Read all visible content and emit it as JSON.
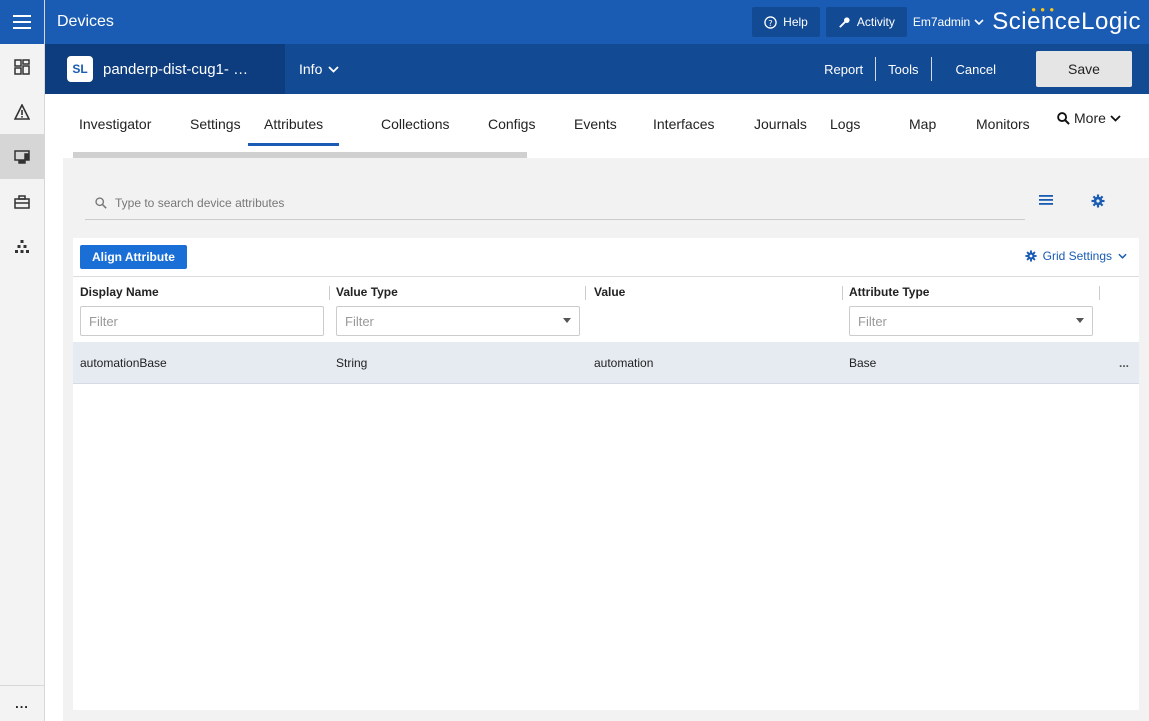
{
  "topbar": {
    "title": "Devices",
    "help_label": "Help",
    "activity_label": "Activity",
    "user_label": "Em7admin",
    "brand": "ScienceLogic"
  },
  "device": {
    "logo_text": "SL",
    "name": "panderp-dist-cug1- …",
    "info_label": "Info",
    "report_label": "Report",
    "tools_label": "Tools",
    "cancel_label": "Cancel",
    "save_label": "Save"
  },
  "tabs": [
    "Investigator",
    "Settings",
    "Attributes",
    "Collections",
    "Configs",
    "Events",
    "Interfaces",
    "Journals",
    "Logs",
    "Map",
    "Monitors"
  ],
  "active_tab": "Attributes",
  "more_label": "More",
  "search": {
    "placeholder": "Type to search device attributes"
  },
  "grid": {
    "align_button": "Align Attribute",
    "grid_settings": "Grid Settings",
    "columns": [
      "Display Name",
      "Value Type",
      "Value",
      "Attribute Type"
    ],
    "filter_placeholder": "Filter",
    "rows": [
      {
        "display_name": "automationBase",
        "value_type": "String",
        "value": "automation",
        "attribute_type": "Base"
      }
    ],
    "row_menu": "..."
  },
  "rail": {
    "more": "..."
  },
  "colors": {
    "primary": "#1a5cb3",
    "dark": "#134a94",
    "button": "#1a6fd6"
  }
}
